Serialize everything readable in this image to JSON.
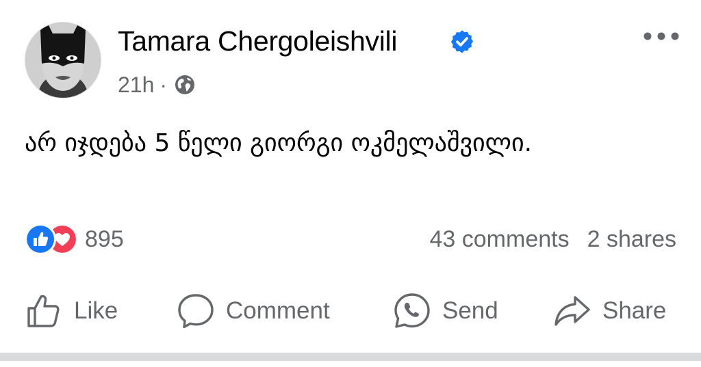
{
  "post": {
    "author": "Tamara Chergoleishvili",
    "time": "21h",
    "separator": "·",
    "text": "არ იჯდება 5 წელი გიორგი ოკმელაშვილი.",
    "reaction_count": "895",
    "comments": "43 comments",
    "shares": "2 shares"
  },
  "actions": {
    "like": "Like",
    "comment": "Comment",
    "send": "Send",
    "share": "Share"
  },
  "colors": {
    "verified_blue": "#1877f2",
    "love_red": "#f33e58",
    "secondary_text": "#65676b",
    "divider": "#d9dadc"
  },
  "icons": [
    "verified-badge-icon",
    "globe-icon",
    "more-options-icon",
    "like-reaction-icon",
    "love-reaction-icon",
    "thumbs-up-icon",
    "comment-bubble-icon",
    "whatsapp-icon",
    "share-arrow-icon"
  ]
}
